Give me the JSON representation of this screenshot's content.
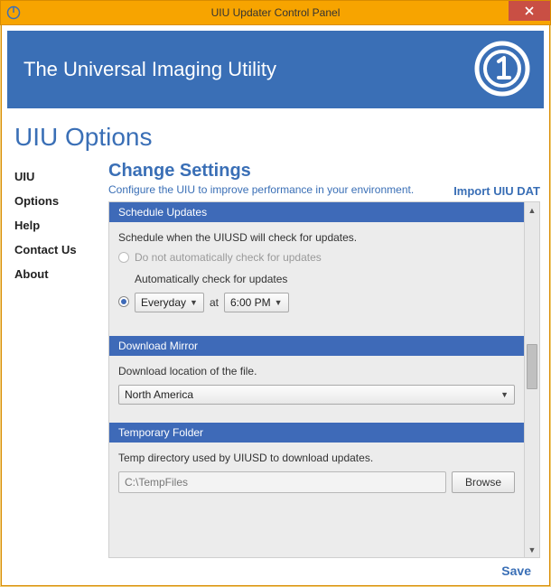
{
  "window": {
    "title": "UIU Updater Control Panel"
  },
  "banner": {
    "title": "The Universal Imaging Utility"
  },
  "heading": "UIU Options",
  "sidebar": {
    "items": [
      "UIU",
      "Options",
      "Help",
      "Contact Us",
      "About"
    ]
  },
  "content": {
    "title": "Change Settings",
    "subtitle": "Configure the UIU to improve performance in your environment.",
    "import_link": "Import UIU DAT"
  },
  "schedule": {
    "header": "Schedule Updates",
    "desc": "Schedule when the UIUSD will check for updates.",
    "opt_off": "Do not automatically check for updates",
    "opt_on": "Automatically check for updates",
    "freq": "Everyday",
    "at": "at",
    "time": "6:00 PM"
  },
  "mirror": {
    "header": "Download Mirror",
    "desc": "Download location of the file.",
    "value": "North America"
  },
  "temp": {
    "header": "Temporary Folder",
    "desc": "Temp directory used by UIUSD to download updates.",
    "path": "C:\\TempFiles",
    "browse": "Browse"
  },
  "footer": {
    "save": "Save"
  }
}
